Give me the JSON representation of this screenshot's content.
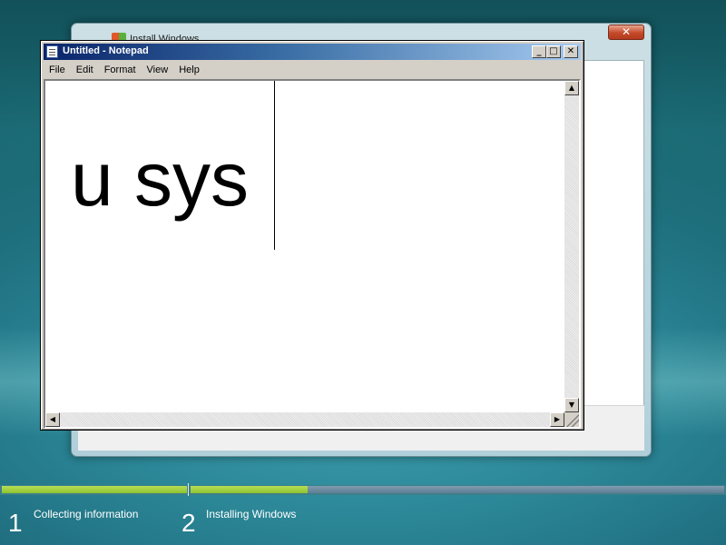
{
  "install_window": {
    "title": "Install Windows",
    "close_label": "✕"
  },
  "notepad": {
    "title": "Untitled - Notepad",
    "min_label": "_",
    "max_label": "□",
    "close_label": "✕",
    "menu": [
      "File",
      "Edit",
      "Format",
      "View",
      "Help"
    ],
    "content": "u sys"
  },
  "progress": {
    "step1_fraction": 1.0,
    "step2_fraction": 0.22,
    "colors": {
      "done": "#8fc331",
      "pending": "#5e7d92"
    }
  },
  "steps": [
    {
      "number": "1",
      "label": "Collecting information"
    },
    {
      "number": "2",
      "label": "Installing Windows"
    }
  ]
}
